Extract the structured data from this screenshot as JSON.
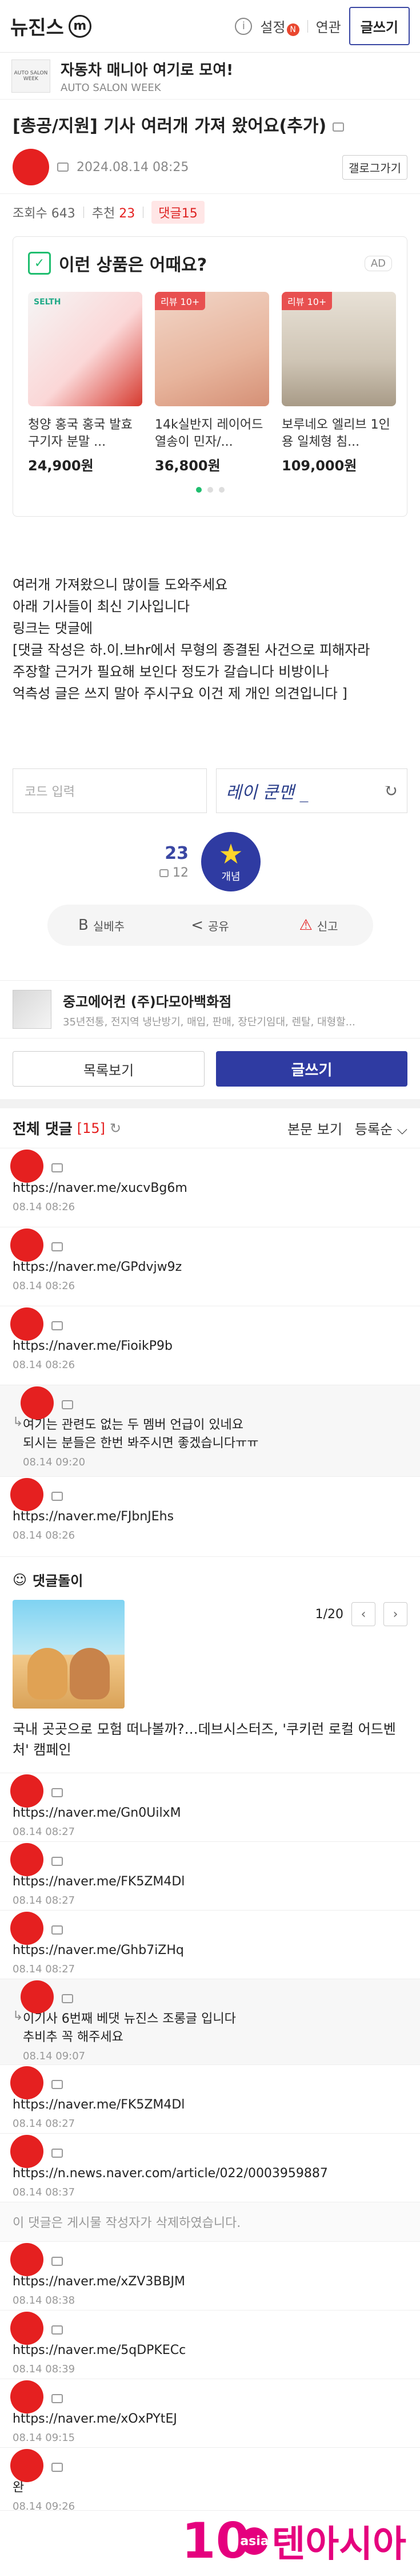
{
  "topbar": {
    "brand": "뉴진스",
    "brand_mark": "m",
    "info_glyph": "i",
    "settings_label": "설정",
    "settings_badge": "N",
    "related_label": "연관",
    "write_label": "글쓰기"
  },
  "cafe": {
    "logo_text": "AUTO SALON WEEK",
    "name": "자동차 매니아 여기로 모여!",
    "sub": "AUTO SALON WEEK"
  },
  "post": {
    "title": "[총공/지원] 기사 여러개 가져 왔어요(추가)",
    "date": "2024.08.14 08:25",
    "gallery_label": "갤로그가기",
    "views_label": "조회수",
    "views": "643",
    "recommend_label": "추천",
    "recommend": "23",
    "comments_label": "댓글",
    "comments": "15"
  },
  "ad": {
    "title": "이런 상품은 어때요?",
    "label": "AD",
    "items": [
      {
        "name": "청양 홍국 홍국 발효 구기자 분말 ...",
        "price": "24,900원",
        "review": "",
        "brand": "SELTH"
      },
      {
        "name": "14k실반지 레이어드 열송이 민자/...",
        "price": "36,800원",
        "review": "리뷰 10+",
        "brand": ""
      },
      {
        "name": "보루네오 엘리브 1인용 일체형 침...",
        "price": "109,000원",
        "review": "리뷰 10+",
        "brand": ""
      }
    ]
  },
  "body": {
    "lines": [
      "여러개 가져왔으니 많이들 도와주세요",
      "아래 기사들이 최신 기사입니다",
      "링크는 댓글에",
      "[댓글 작성은 하.이.브hr에서 무형의 종결된 사건으로 피해자라",
      "주장할 근거가 필요해 보인다  정도가 갈습니다 비방이나",
      "억측성 글은 쓰지 말아 주시구요  이건 제 개인 의견입니다 ]"
    ]
  },
  "captcha": {
    "placeholder": "코드 입력",
    "image_text": "레이 쿤맨 _",
    "refresh_glyph": "↻"
  },
  "votes": {
    "up": "23",
    "down": "12",
    "button_label": "개념",
    "star_glyph": "★"
  },
  "actions": [
    {
      "icon": "B",
      "label": "실베추"
    },
    {
      "icon": "<",
      "label": "공유"
    },
    {
      "icon": "⚠",
      "label": "신고"
    }
  ],
  "banner": {
    "title": "중고에어컨 (주)다모아백화점",
    "sub": "35년전통, 전지역 냉난방기, 매입, 판매, 장단기임대, 렌탈, 대형할..."
  },
  "nav": {
    "list_label": "목록보기",
    "write_label": "글쓰기"
  },
  "comments_head": {
    "title": "전체 댓글",
    "count": "[15]",
    "reload_glyph": "↻",
    "view_label": "본문 보기",
    "sort_label": "등록순",
    "sort_glyph": "⌵"
  },
  "comments_a": [
    {
      "text": "https://naver.me/xucvBg6m",
      "date": "08.14 08:26",
      "reply": false
    },
    {
      "text": "https://naver.me/GPdvjw9z",
      "date": "08.14 08:26",
      "reply": false
    },
    {
      "text": "https://naver.me/FioikP9b",
      "date": "08.14 08:26",
      "reply": false
    },
    {
      "text": "여기는 관련도 없는 두 멤버 언급이 있네요\n되시는 분들은 한번 봐주시면 좋겠습니다ㅠㅠ",
      "date": "08.14 09:20",
      "reply": true
    },
    {
      "text": "https://naver.me/FJbnJEhs",
      "date": "08.14 08:26",
      "reply": false
    }
  ],
  "dolls": {
    "title": "댓글돌이",
    "icon": "☺",
    "pager": "1/20",
    "prev": "‹",
    "next": "›",
    "caption": "국내 곳곳으로 모험 떠나볼까?…데브시스터즈, '쿠키런 로컬 어드벤처' 캠페인"
  },
  "comments_b": [
    {
      "text": "https://naver.me/Gn0UilxM",
      "date": "08.14 08:27",
      "reply": false
    },
    {
      "text": "https://naver.me/FK5ZM4Dl",
      "date": "08.14 08:27",
      "reply": false
    },
    {
      "text": "https://naver.me/Ghb7iZHq",
      "date": "08.14 08:27",
      "reply": false
    },
    {
      "text": "이기사 6번째 베댓 뉴진스 조롱글 입니다\n추비추 꼭 해주세요",
      "date": "08.14 09:07",
      "reply": true
    },
    {
      "text": "https://naver.me/FK5ZM4Dl",
      "date": "08.14 08:27",
      "reply": false
    },
    {
      "text": "https://n.news.naver.com/article/022/0003959887",
      "date": "08.14 08:37",
      "reply": false
    }
  ],
  "deleted_text": "이 댓글은 게시물 작성자가 삭제하였습니다.",
  "comments_c": [
    {
      "text": "https://naver.me/xZV3BBJM",
      "date": "08.14 08:38",
      "reply": false
    },
    {
      "text": "https://naver.me/5qDPKECc",
      "date": "08.14 08:39",
      "reply": false
    },
    {
      "text": "https://naver.me/xOxPYtEJ",
      "date": "08.14 09:15",
      "reply": false
    },
    {
      "text": "완",
      "date": "08.14 09:26",
      "reply": false
    }
  ],
  "watermark": {
    "ten": "10",
    "asia": "asia",
    "name": "텐아시아",
    "color": "#e5007e"
  },
  "colors": {
    "accent": "#2f3ba2",
    "red": "#e52020",
    "green": "#1fbe6f"
  }
}
